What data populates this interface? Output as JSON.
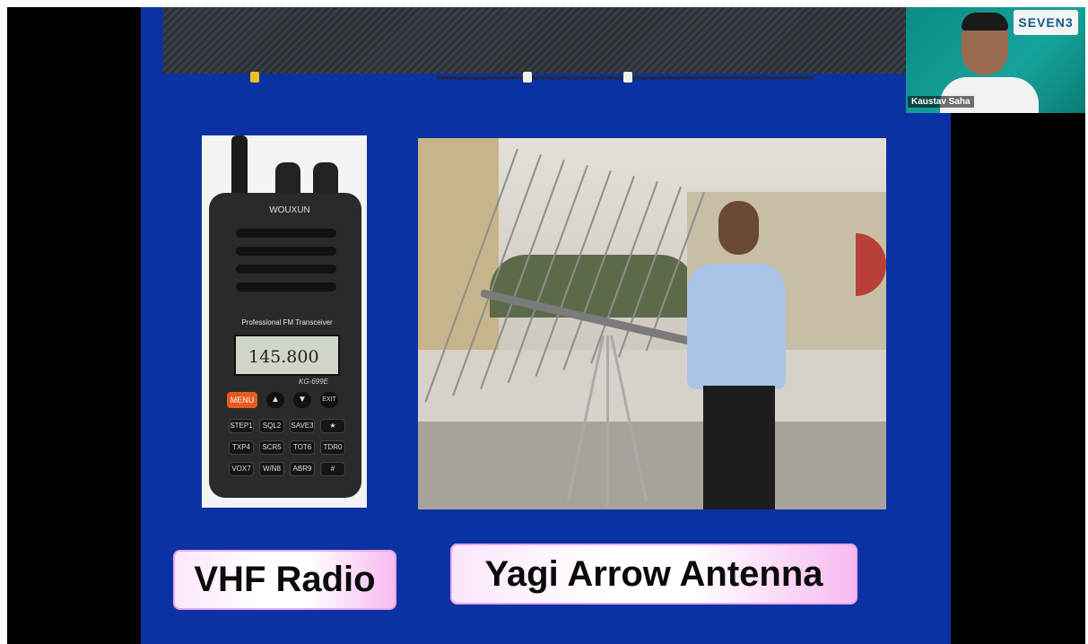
{
  "slide": {
    "radio_display": "145.800",
    "radio_brand": "WOUXUN",
    "radio_subtitle": "Professional FM Transceiver",
    "radio_model": "KG-699E",
    "radio_menu_key": "MENU",
    "radio_exit_key": "EXIT",
    "radio_keys": [
      "STEP1",
      "SQL2",
      "SAVE3",
      "★",
      "TXP4",
      "SCR5",
      "TOT6",
      "TDR0",
      "VOX7",
      "W/N8",
      "ABR9",
      "#"
    ],
    "label_left": "VHF Radio",
    "label_right": "Yagi Arrow Antenna"
  },
  "camera": {
    "participant_name": "Kaustav Saha",
    "logo_text": "SEVEN3"
  },
  "colors": {
    "slide_background": "#0b32a2",
    "label_gradient_end": "#f7b9f0",
    "camera_background": "#15a39b"
  }
}
